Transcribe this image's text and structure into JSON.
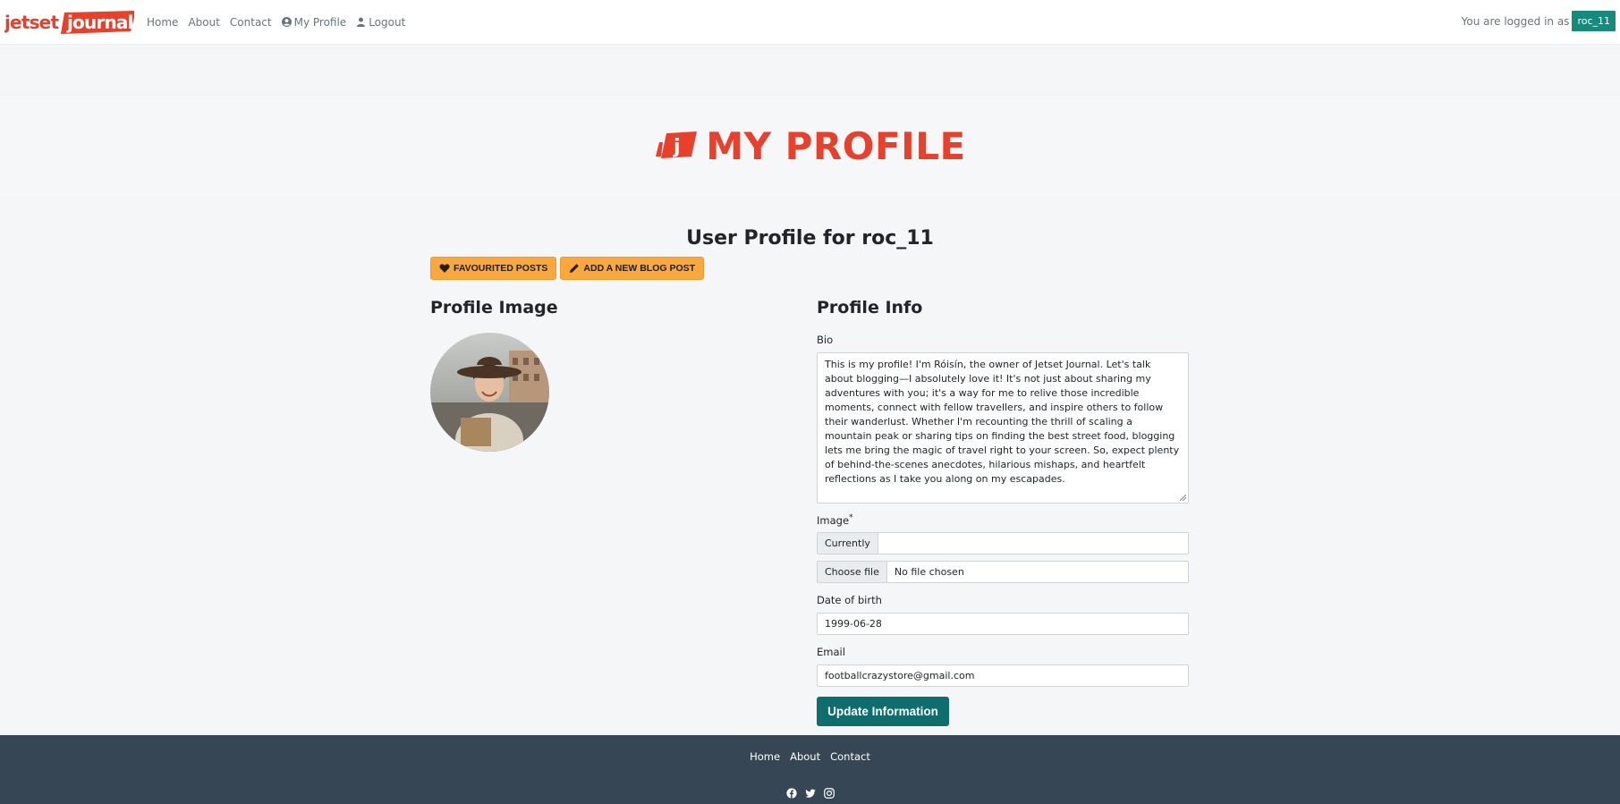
{
  "nav": {
    "brand": "jetset journal",
    "links": [
      {
        "label": "Home"
      },
      {
        "label": "About"
      },
      {
        "label": "Contact"
      },
      {
        "label": "My Profile",
        "icon": "user-circle-icon"
      },
      {
        "label": "Logout",
        "icon": "user-icon"
      }
    ],
    "login_text": "You are logged in as",
    "username": "roc_11"
  },
  "hero": {
    "title": "MY PROFILE",
    "logo_letter": "j"
  },
  "page": {
    "heading": "User Profile for roc_11",
    "buttons": {
      "favourited": "FAVOURITED POSTS",
      "add_post": "ADD A NEW BLOG POST"
    }
  },
  "left": {
    "title": "Profile Image"
  },
  "form": {
    "title": "Profile Info",
    "bio_label": "Bio",
    "bio_value": "This is my profile! I'm Róisín, the owner of Jetset Journal. Let's talk about blogging—I absolutely love it! It's not just about sharing my adventures with you; it's a way for me to relive those incredible moments, connect with fellow travellers, and inspire others to follow their wanderlust. Whether I'm recounting the thrill of scaling a mountain peak or sharing tips on finding the best street food, blogging lets me bring the magic of travel right to your screen. So, expect plenty of behind-the-scenes anecdotes, hilarious mishaps, and heartfelt reflections as I take you along on my escapades.",
    "image_label": "Image",
    "required_mark": "*",
    "currently_label": "Currently",
    "currently_value": "",
    "choose_file": "Choose file",
    "no_file": "No file chosen",
    "dob_label": "Date of birth",
    "dob_value": "1999-06-28",
    "email_label": "Email",
    "email_value": "footballcrazystore@gmail.com",
    "submit": "Update Information"
  },
  "footer": {
    "links": [
      "Home",
      "About",
      "Contact"
    ],
    "social_icons": [
      "facebook-icon",
      "twitter-icon",
      "instagram-icon"
    ]
  },
  "colors": {
    "brand_red": "#e8402a",
    "accent_orange": "#f8a83d",
    "teal": "#0e6e6e",
    "badge_teal": "#178a7e",
    "footer": "#364654"
  }
}
